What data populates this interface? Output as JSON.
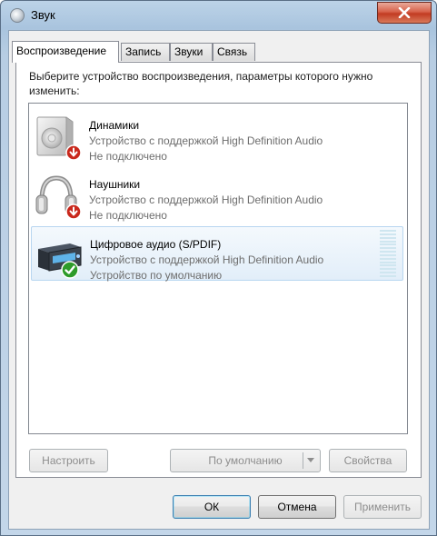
{
  "window": {
    "title": "Звук",
    "close_label": "✕"
  },
  "tabs": [
    {
      "label": "Воспроизведение"
    },
    {
      "label": "Запись"
    },
    {
      "label": "Звуки"
    },
    {
      "label": "Связь"
    }
  ],
  "instruction": "Выберите устройство воспроизведения, параметры которого нужно изменить:",
  "devices": [
    {
      "name": "Динамики",
      "driver": "Устройство с поддержкой High Definition Audio",
      "status": "Не подключено",
      "icon": "speakers-icon",
      "badge": "disconnected-badge-icon",
      "selected": false
    },
    {
      "name": "Наушники",
      "driver": "Устройство с поддержкой High Definition Audio",
      "status": "Не подключено",
      "icon": "headphones-icon",
      "badge": "disconnected-badge-icon",
      "selected": false
    },
    {
      "name": "Цифровое аудио (S/PDIF)",
      "driver": "Устройство с поддержкой High Definition Audio",
      "status": "Устройство по умолчанию",
      "icon": "digital-audio-icon",
      "badge": "default-check-icon",
      "selected": true
    }
  ],
  "buttons": {
    "configure": "Настроить",
    "set_default": "По умолчанию",
    "properties": "Свойства",
    "ok": "ОК",
    "cancel": "Отмена",
    "apply": "Применить"
  },
  "colors": {
    "accent": "#3c7fb1",
    "selection_border": "#b8d6f0",
    "close_red": "#c23b22",
    "disabled_text": "#8d8d8d"
  }
}
